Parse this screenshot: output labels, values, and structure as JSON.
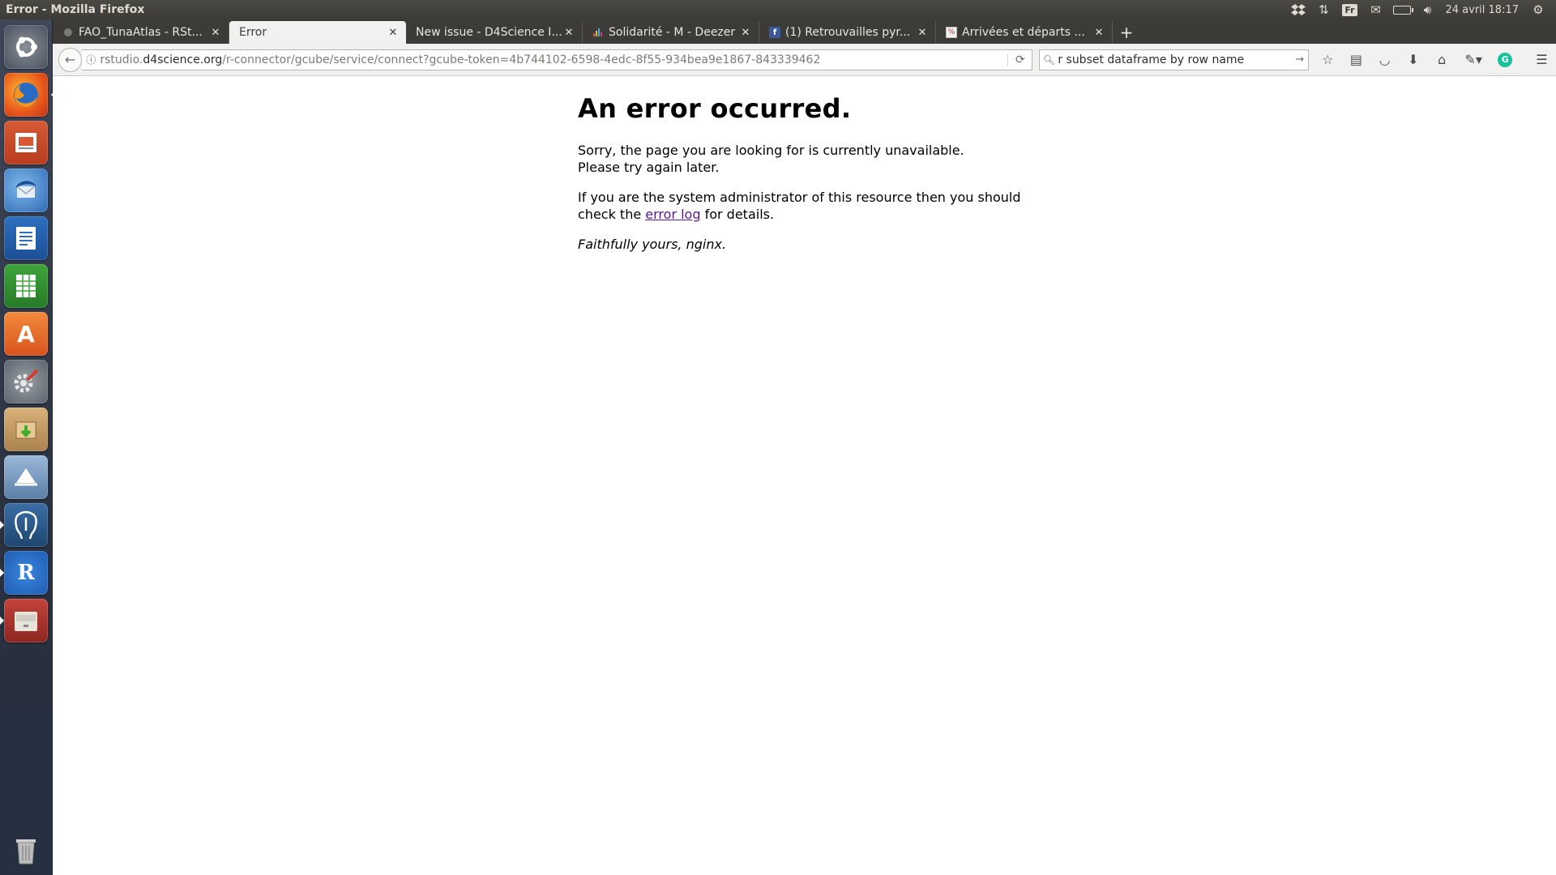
{
  "top_panel": {
    "window_title": "Error - Mozilla Firefox",
    "keyboard_layout": "Fr",
    "clock": "24 avril 18:17"
  },
  "launcher": {
    "items": [
      {
        "name": "dash-home",
        "glyph": ""
      },
      {
        "name": "firefox",
        "glyph": ""
      },
      {
        "name": "libreoffice-impress",
        "glyph": ""
      },
      {
        "name": "thunderbird",
        "glyph": ""
      },
      {
        "name": "libreoffice-writer",
        "glyph": ""
      },
      {
        "name": "libreoffice-calc",
        "glyph": ""
      },
      {
        "name": "ubuntu-software-center",
        "glyph": "A"
      },
      {
        "name": "system-settings",
        "glyph": ""
      },
      {
        "name": "archive-manager",
        "glyph": ""
      },
      {
        "name": "shutter",
        "glyph": ""
      },
      {
        "name": "pgadmin",
        "glyph": ""
      },
      {
        "name": "r",
        "glyph": "R"
      },
      {
        "name": "file-manager",
        "glyph": ""
      }
    ],
    "trash": "trash"
  },
  "tabs": [
    {
      "label": "FAO_TunaAtlas - RSt...",
      "active": false
    },
    {
      "label": "Error",
      "active": true
    },
    {
      "label": "New issue - D4Science I...",
      "active": false
    },
    {
      "label": "Solidarité - M - Deezer",
      "active": false
    },
    {
      "label": "(1) Retrouvailles pyr...",
      "active": false
    },
    {
      "label": "Arrivées et départs ...",
      "active": false
    }
  ],
  "navbar": {
    "url_domain_prefix": "rstudio.",
    "url_domain": "d4science.org",
    "url_path": "/r-connector/gcube/service/connect?gcube-token=4b744102-6598-4edc-8f55-934bea9e1867-843339462",
    "search_value": "r subset dataframe by row name"
  },
  "page": {
    "heading": "An error occurred.",
    "p1_line1": "Sorry, the page you are looking for is currently unavailable.",
    "p1_line2": "Please try again later.",
    "p2_before": "If you are the system administrator of this resource then you should check the ",
    "p2_link": "error log",
    "p2_after": " for details.",
    "signature": "Faithfully yours, nginx."
  },
  "colors": {
    "panel": "#3c3b37",
    "link_visited": "#551a8b",
    "grammarly": "#15c39a"
  }
}
